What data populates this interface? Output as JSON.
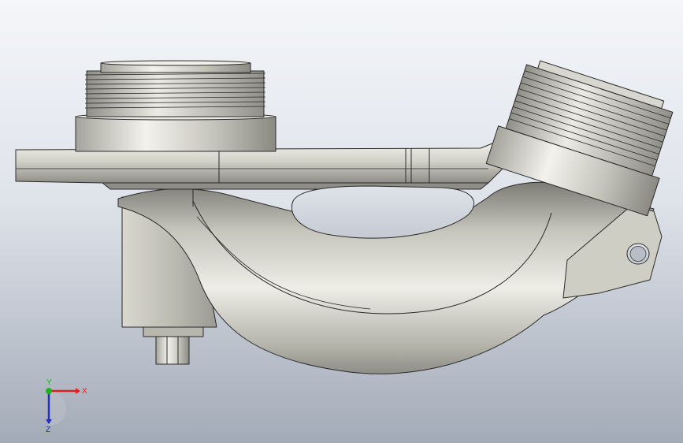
{
  "view": {
    "background_top": "#f4f6f9",
    "background_bottom": "#a3abb8",
    "part_color": "#c9c8bf",
    "edge_color": "#2a2a2a"
  },
  "triad": {
    "x_label": "X",
    "y_label": "Y",
    "z_label": "Z",
    "x_color": "#e02020",
    "y_color": "#20b020",
    "z_color": "#2030c0"
  }
}
